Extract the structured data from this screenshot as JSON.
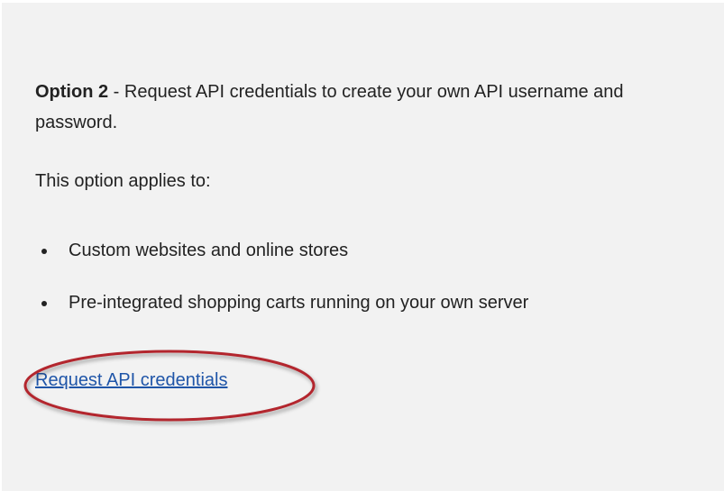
{
  "option": {
    "label": "Option 2",
    "description": " - Request API credentials to create your own API username and password."
  },
  "applies_heading": "This option applies to:",
  "applies_items": [
    "Custom websites and online stores",
    "Pre-integrated shopping carts running on your own server"
  ],
  "link": {
    "label": "Request API credentials",
    "color": "#1f55a8"
  },
  "highlight": {
    "color": "#b3272d",
    "shape": "ellipse"
  }
}
